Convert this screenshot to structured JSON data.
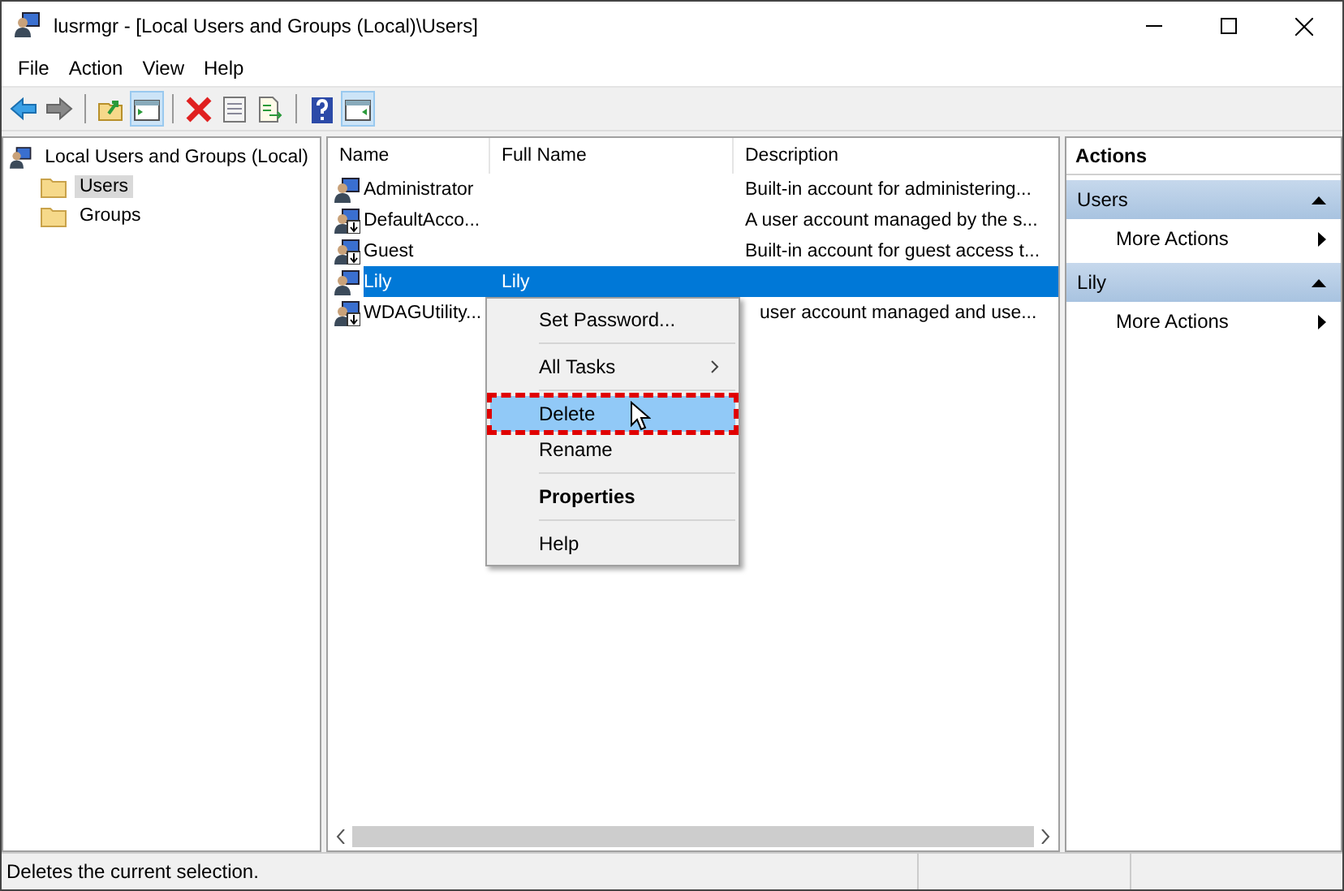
{
  "window": {
    "title": "lusrmgr - [Local Users and Groups (Local)\\Users]"
  },
  "menu_bar": [
    "File",
    "Action",
    "View",
    "Help"
  ],
  "toolbar": [
    {
      "kind": "back",
      "pressed": false
    },
    {
      "kind": "forward",
      "pressed": false
    },
    {
      "kind": "separator"
    },
    {
      "kind": "up",
      "pressed": false
    },
    {
      "kind": "tree",
      "pressed": true
    },
    {
      "kind": "separator"
    },
    {
      "kind": "delete",
      "pressed": false
    },
    {
      "kind": "properties",
      "pressed": false
    },
    {
      "kind": "export",
      "pressed": false
    },
    {
      "kind": "separator"
    },
    {
      "kind": "help",
      "pressed": false
    },
    {
      "kind": "actionpane",
      "pressed": true
    }
  ],
  "tree": {
    "label": "Local Users and Groups (Local)",
    "children": [
      {
        "label": "Users",
        "selected": true
      },
      {
        "label": "Groups",
        "selected": false
      }
    ]
  },
  "list": {
    "columns": [
      "Name",
      "Full Name",
      "Description"
    ],
    "rows": [
      {
        "name": "Administrator",
        "full_name": "",
        "description": "Built-in account for administering...",
        "disabled": false,
        "selected": false
      },
      {
        "name": "DefaultAcco...",
        "full_name": "",
        "description": "A user account managed by the s...",
        "disabled": true,
        "selected": false
      },
      {
        "name": "Guest",
        "full_name": "",
        "description": "Built-in account for guest access t...",
        "disabled": true,
        "selected": false
      },
      {
        "name": "Lily",
        "full_name": "Lily",
        "description": "",
        "disabled": false,
        "selected": true
      },
      {
        "name": "WDAGUtility...",
        "full_name": "",
        "description": "user account managed and use...",
        "disabled": true,
        "selected": false
      }
    ]
  },
  "context_menu": {
    "items": [
      {
        "label": "Set Password...",
        "submenu": false,
        "bold": false,
        "selected": false,
        "annotated": false,
        "separator_after": true
      },
      {
        "label": "All Tasks",
        "submenu": true,
        "bold": false,
        "selected": false,
        "annotated": false,
        "separator_after": true
      },
      {
        "label": "Delete",
        "submenu": false,
        "bold": false,
        "selected": true,
        "annotated": true,
        "separator_after": false
      },
      {
        "label": "Rename",
        "submenu": false,
        "bold": false,
        "selected": false,
        "annotated": false,
        "separator_after": true
      },
      {
        "label": "Properties",
        "submenu": false,
        "bold": true,
        "selected": false,
        "annotated": false,
        "separator_after": true
      },
      {
        "label": "Help",
        "submenu": false,
        "bold": false,
        "selected": false,
        "annotated": false,
        "separator_after": false
      }
    ]
  },
  "actions": {
    "title": "Actions",
    "sections": [
      {
        "title": "Users",
        "expanded": true,
        "items": [
          "More Actions"
        ]
      },
      {
        "title": "Lily",
        "expanded": true,
        "items": [
          "More Actions"
        ]
      }
    ]
  },
  "status_bar": {
    "text": "Deletes the current selection."
  }
}
